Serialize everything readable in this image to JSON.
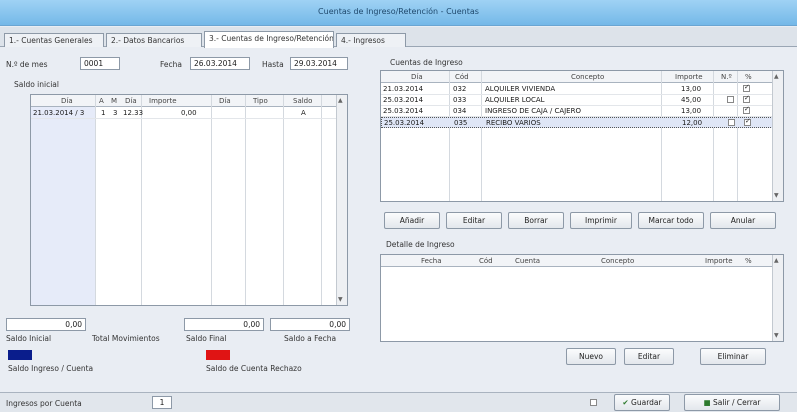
{
  "window": {
    "title": "Cuentas de Ingreso/Retención - Cuentas"
  },
  "tabs": [
    {
      "label": "1.- Cuentas Generales"
    },
    {
      "label": "2.- Datos Bancarios"
    },
    {
      "label": "3.- Cuentas de Ingreso/Retención"
    },
    {
      "label": "4.- Ingresos"
    }
  ],
  "left": {
    "month_label": "N.º de mes",
    "month_value": "0001",
    "date_label": "Fecha",
    "date_value": "26.03.2014",
    "until_label": "Hasta",
    "until_value": "29.03.2014",
    "section_label": "Saldo inicial",
    "headers": [
      "Día",
      "A",
      "M",
      "Día",
      "Importe",
      "Día",
      "Tipo",
      "Saldo"
    ],
    "rows": [
      {
        "date": "21.03.2014 / 3",
        "a": "1",
        "m": "3",
        "day": "12.33",
        "amount": "0,00",
        "type": "",
        "balance": "A"
      }
    ],
    "totals": {
      "a": "0,00",
      "b": "0,00",
      "c": "0,00"
    },
    "total_labels": {
      "a": "Saldo Inicial",
      "b": "Total Movimientos",
      "c": "Saldo Final",
      "d": "Saldo a Fecha"
    },
    "legend": {
      "blue_label": "Saldo Ingreso / Cuenta",
      "red_label": "Saldo de Cuenta Rechazo"
    }
  },
  "movements": {
    "title": "Cuentas de Ingreso",
    "headers": [
      "Día",
      "Cód",
      "Concepto",
      "Importe",
      "N.º",
      "%"
    ],
    "rows": [
      {
        "date": "21.03.2014",
        "code": "032",
        "concept": "ALQUILER VIVIENDA",
        "amount": "13,00"
      },
      {
        "date": "25.03.2014",
        "code": "033",
        "concept": "ALQUILER LOCAL",
        "amount": "45,00"
      },
      {
        "date": "25.03.2014",
        "code": "034",
        "concept": "INGRESO DE CAJA / CAJERO",
        "amount": "13,00"
      },
      {
        "date": "25.03.2014",
        "code": "035",
        "concept": "RECIBO VARIOS",
        "amount": "12,00"
      }
    ],
    "buttons": [
      "Añadir",
      "Editar",
      "Borrar",
      "Imprimir",
      "Marcar todo",
      "Anular"
    ]
  },
  "detail": {
    "title": "Detalle de Ingreso",
    "headers": [
      "Fecha",
      "Cód",
      "Cuenta",
      "Concepto",
      "Importe",
      "%"
    ],
    "buttons": {
      "b1": "Nuevo",
      "b2": "Editar",
      "b3": "Eliminar"
    }
  },
  "status": {
    "text": "Ingresos por Cuenta",
    "item": "1",
    "save": "Guardar",
    "exit": "Salir / Cerrar"
  },
  "colors": {
    "blue_swatch": "#0a1d8c",
    "red_swatch": "#e01414"
  }
}
